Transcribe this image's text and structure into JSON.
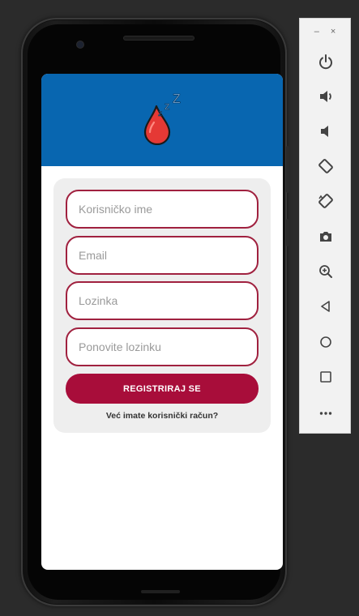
{
  "emulator": {
    "window_controls": {
      "minimize": "–",
      "close": "×"
    },
    "toolbar_icons": [
      "power-icon",
      "volume-up-icon",
      "volume-down-icon",
      "rotate-left-icon",
      "rotate-right-icon",
      "camera-icon",
      "zoom-icon",
      "back-icon",
      "home-icon",
      "overview-icon",
      "more-icon"
    ]
  },
  "app": {
    "header_color": "#0866b0",
    "logo_text": "zzZ",
    "form": {
      "username_placeholder": "Korisničko ime",
      "email_placeholder": "Email",
      "password_placeholder": "Lozinka",
      "repeat_password_placeholder": "Ponovite lozinku",
      "register_label": "REGISTRIRAJ SE",
      "login_link": "Već imate korisnički račun?"
    },
    "colors": {
      "accent": "#a80d3a",
      "field_border": "#a0213f",
      "card": "#eeeeee"
    }
  }
}
